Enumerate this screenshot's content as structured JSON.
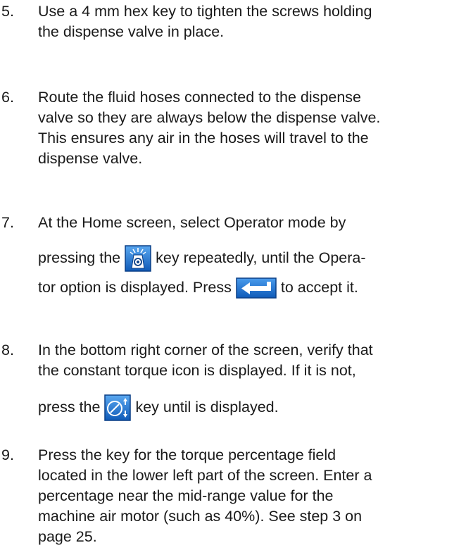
{
  "steps": [
    {
      "number": "5.",
      "lines": [
        "Use a 4 mm hex key to tighten the screws holding",
        "the dispense valve in place."
      ]
    },
    {
      "number": "6.",
      "lines": [
        "Route the fluid hoses connected to the dispense",
        "valve so they are always below the dispense valve.",
        "This ensures any air in the hoses will travel to the",
        "dispense valve."
      ]
    },
    {
      "number": "7.",
      "line1": "At the Home screen, select Operator mode by",
      "line2_before": "pressing the",
      "line2_icon": "operator-mode-key-icon",
      "line2_after": "key repeatedly, until the Opera-",
      "line3_before": "tor option is displayed. Press",
      "line3_icon": "enter-key-icon",
      "line3_after": "to accept it."
    },
    {
      "number": "8.",
      "line1": "In the bottom right corner of the screen, verify that",
      "line2": "the constant torque icon is displayed. If it is not,",
      "line3_before": "press the",
      "line3_icon": "control-mode-toggle-key-icon",
      "line3_after": "key until is displayed."
    },
    {
      "number": "9.",
      "lines": [
        "Press the key for the torque percentage field",
        "located in the lower left part of the screen. Enter a",
        "percentage near the mid-range value for the",
        "machine air motor (such as 40%). See step 3 on",
        "page 25."
      ]
    }
  ],
  "colors": {
    "key_blue": "#1565c0",
    "key_blue_light": "#3d8ee6",
    "text": "#1a1a1a"
  }
}
